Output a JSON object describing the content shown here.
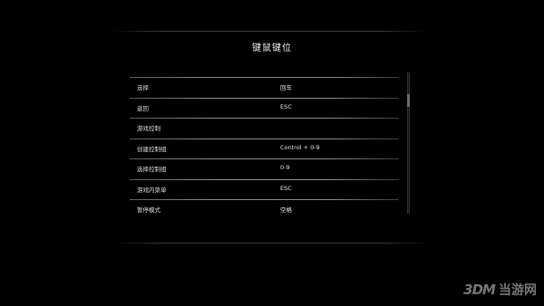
{
  "panel": {
    "title": "键鼠键位"
  },
  "bindings": [
    {
      "action": "选择",
      "key": "回车"
    },
    {
      "action": "返回",
      "key": "ESC"
    },
    {
      "action": "游戏控制",
      "key": ""
    },
    {
      "action": "创建控制组",
      "key": "Control + 0-9"
    },
    {
      "action": "选择控制组",
      "key": "0-9"
    },
    {
      "action": "游戏内菜单",
      "key": "ESC"
    },
    {
      "action": "暂停模式",
      "key": "空格"
    }
  ],
  "watermark": {
    "logo": "3DM",
    "site": "当游网"
  },
  "colors": {
    "background": "#000000",
    "text": "#e6e6e6",
    "separator": "#8a8a8a"
  }
}
